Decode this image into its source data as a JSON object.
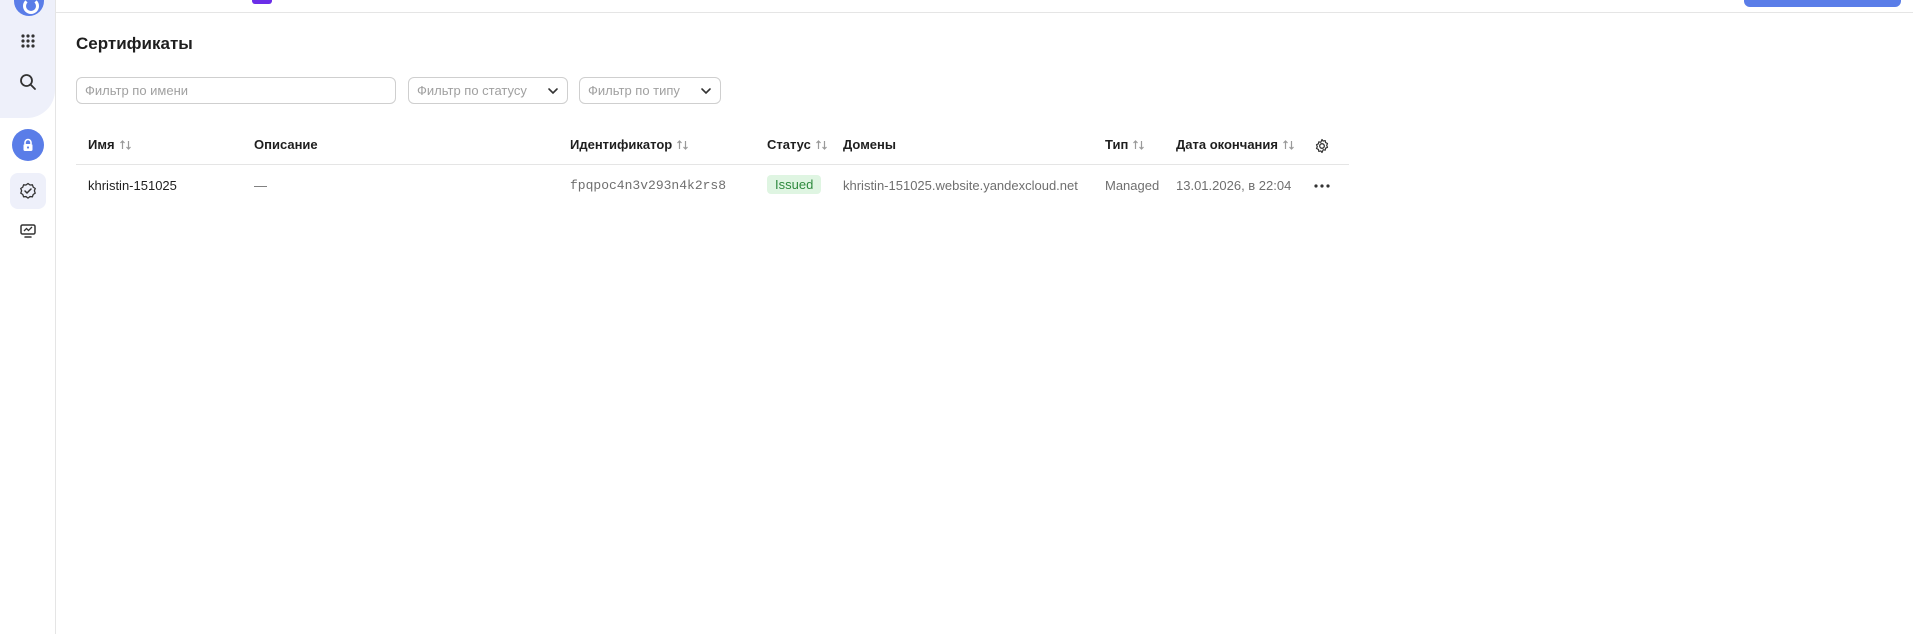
{
  "page": {
    "title": "Сертификаты"
  },
  "filters": {
    "name_placeholder": "Фильтр по имени",
    "status_placeholder": "Фильтр по статусу",
    "type_placeholder": "Фильтр по типу"
  },
  "table": {
    "columns": [
      "Имя",
      "Описание",
      "Идентификатор",
      "Статус",
      "Домены",
      "Тип",
      "Дата окончания"
    ],
    "rows": [
      {
        "name": "khristin-151025",
        "description": "—",
        "id": "fpqpoc4n3v293n4k2rs8",
        "status": "Issued",
        "domain": "khristin-151025.website.yandexcloud.net",
        "type": "Managed",
        "expires": "13.01.2026, в 22:04"
      }
    ]
  },
  "colors": {
    "accent": "#5a7de8",
    "status_bg": "#dff5e2",
    "status_text": "#2e8a3e"
  },
  "icons": [
    "logo-icon",
    "apps-grid-icon",
    "search-icon",
    "lock-icon",
    "certificate-icon",
    "monitor-icon",
    "sort-icon",
    "chevron-down-icon",
    "gear-icon",
    "more-icon"
  ]
}
